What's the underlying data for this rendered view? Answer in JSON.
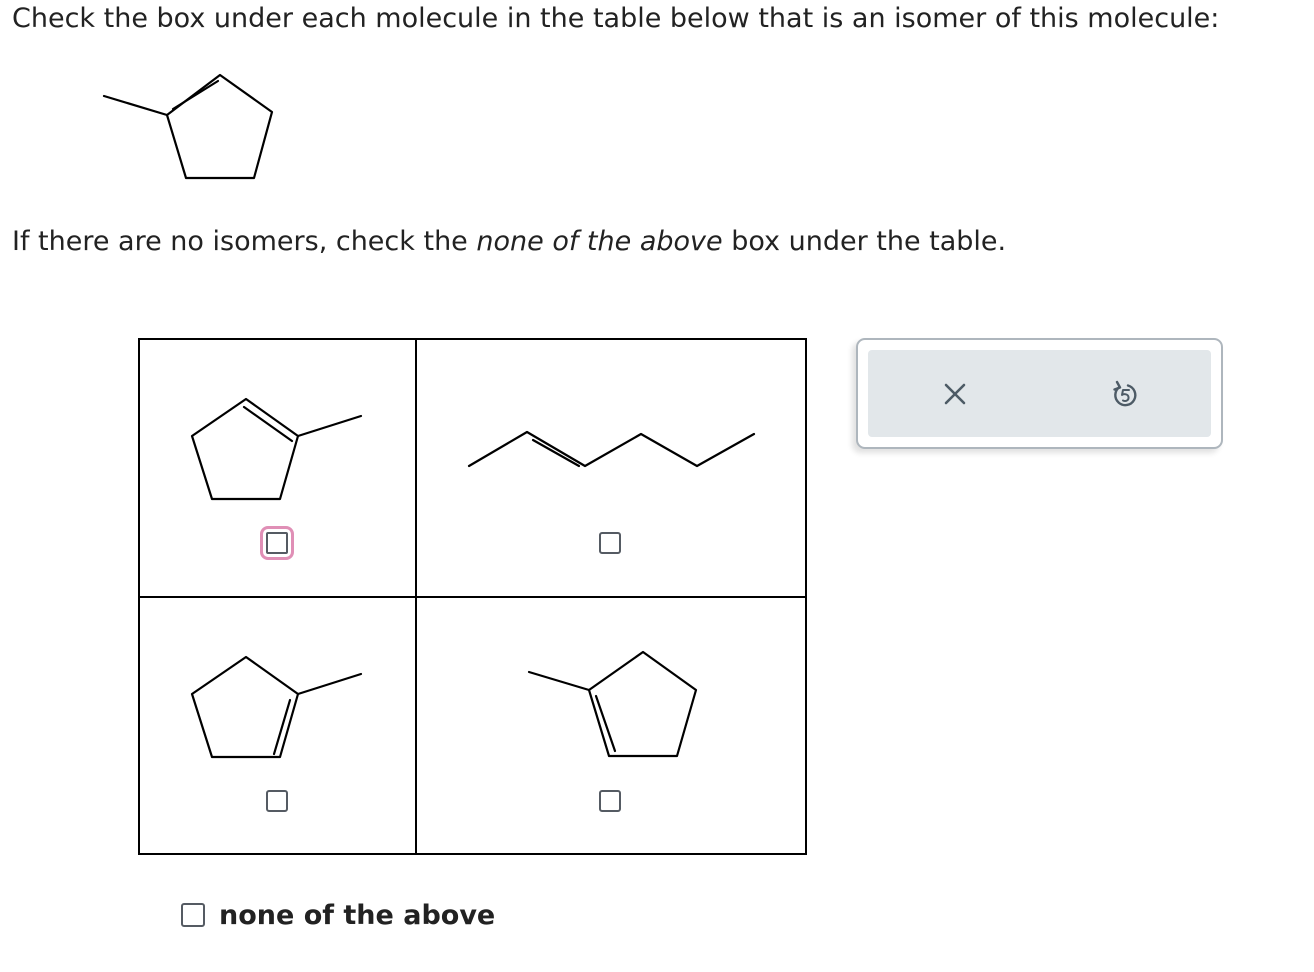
{
  "prompt": {
    "line1": "Check the box under each molecule in the table below that is an isomer of this molecule:",
    "line2_before": "If there are no isomers, check the ",
    "line2_italic": "none of the above",
    "line2_after": " box under the table."
  },
  "target_molecule": {
    "icon": "1-methylcyclopentene-structure-icon"
  },
  "options": [
    {
      "icon": "1-methylcyclopentene-structure-icon",
      "checked": false,
      "focused": true
    },
    {
      "icon": "hex-2-ene-structure-icon",
      "checked": false,
      "focused": false
    },
    {
      "icon": "methylcyclopentene-structure-icon",
      "checked": false,
      "focused": false
    },
    {
      "icon": "methylcyclopentene-structure-icon",
      "checked": false,
      "focused": false
    }
  ],
  "none_of_the_above": {
    "label": "none of the above",
    "checked": false
  },
  "toolbar": {
    "clear_icon": "x-icon",
    "undo_icon": "undo-icon"
  },
  "colors": {
    "focus_ring": "#e08fb6",
    "checkbox_border": "#555b63",
    "panel_bg": "#e2e7ea",
    "panel_border": "#aeb6bd",
    "icon_color": "#4d5b66"
  }
}
